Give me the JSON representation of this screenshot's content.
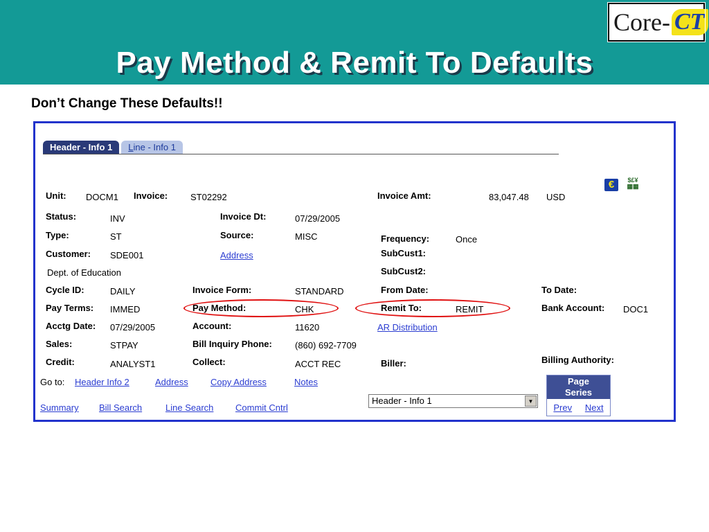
{
  "slide": {
    "title": "Pay Method & Remit To Defaults",
    "subtitle": "Don’t Change These Defaults!!",
    "logo_core": "Core-",
    "logo_ct": "CT",
    "colors": {
      "banner": "#139a96",
      "frame": "#2233cc",
      "circle": "#e01010"
    }
  },
  "tabs": {
    "active": "Header - Info 1",
    "inactive_first": "L",
    "inactive_rest": "ine - Info 1"
  },
  "icons": {
    "euro": "€",
    "currency_top": "$£¥",
    "currency_bottom": "▦▦"
  },
  "fields": {
    "unit_label": "Unit:",
    "unit": "DOCM1",
    "invoice_label": "Invoice:",
    "invoice": "ST02292",
    "invoice_amt_label": "Invoice Amt:",
    "invoice_amt": "83,047.48",
    "currency": "USD",
    "status_label": "Status:",
    "status": "INV",
    "invoice_dt_label": "Invoice Dt:",
    "invoice_dt": "07/29/2005",
    "type_label": "Type:",
    "type": "ST",
    "source_label": "Source:",
    "source": "MISC",
    "frequency_label": "Frequency:",
    "frequency": "Once",
    "customer_label": "Customer:",
    "customer": "SDE001",
    "address_link": "Address",
    "subcust1_label": "SubCust1:",
    "dept": "Dept. of Education",
    "subcust2_label": "SubCust2:",
    "cycle_label": "Cycle ID:",
    "cycle": "DAILY",
    "invoice_form_label": "Invoice Form:",
    "invoice_form": "STANDARD",
    "from_date_label": "From Date:",
    "to_date_label": "To Date:",
    "pay_terms_label": "Pay Terms:",
    "pay_terms": "IMMED",
    "pay_method_label": "Pay Method:",
    "pay_method": "CHK",
    "remit_to_label": "Remit To:",
    "remit_to": "REMIT",
    "bank_account_label": "Bank Account:",
    "bank_account": "DOC1",
    "acctg_date_label": "Acctg Date:",
    "acctg_date": "07/29/2005",
    "account_label": "Account:",
    "account": "11620",
    "ar_distribution_link": "AR Distribution",
    "sales_label": "Sales:",
    "sales": "STPAY",
    "bill_inquiry_label": "Bill Inquiry Phone:",
    "bill_inquiry": "(860) 692-7709",
    "credit_label": "Credit:",
    "credit": "ANALYST1",
    "collect_label": "Collect:",
    "collect": "ACCT REC",
    "biller_label": "Biller:",
    "billing_authority_label": "Billing Authority:"
  },
  "goto": {
    "label": "Go to:",
    "links": [
      "Header Info 2",
      "Address",
      "Copy Address",
      "Notes"
    ]
  },
  "bottom_links": [
    "Summary",
    "Bill Search",
    "Line Search",
    "Commit Cntrl"
  ],
  "select": {
    "value": "Header - Info 1",
    "arrow": "▼"
  },
  "page_series": {
    "title_line1": "Page",
    "title_line2": "Series",
    "prev": "Prev",
    "next": "Next"
  }
}
